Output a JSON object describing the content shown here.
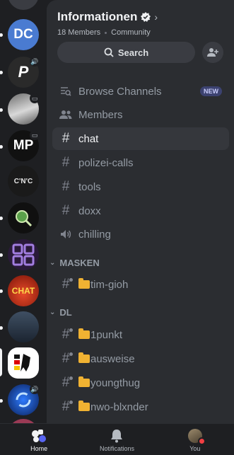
{
  "server": {
    "name": "Informationen",
    "members": "18 Members",
    "type": "Community",
    "search_label": "Search"
  },
  "rail": {
    "items": [
      {
        "label": "DC"
      },
      {
        "label": "P"
      },
      {
        "label": ""
      },
      {
        "label": "MP"
      },
      {
        "label": "C'N'C"
      },
      {
        "label": ""
      },
      {
        "label": ""
      },
      {
        "label": "CHAT"
      },
      {
        "label": ""
      },
      {
        "label": ""
      },
      {
        "label": ""
      }
    ]
  },
  "channels": {
    "browse": {
      "label": "Browse Channels",
      "badge": "NEW"
    },
    "members": {
      "label": "Members"
    },
    "top": [
      {
        "label": "chat",
        "icon": "hash-icon"
      },
      {
        "label": "polizei-calls",
        "icon": "hash-icon"
      },
      {
        "label": "tools",
        "icon": "hash-icon"
      },
      {
        "label": "doxx",
        "icon": "hash-icon"
      },
      {
        "label": "chilling",
        "icon": "speaker-icon"
      }
    ],
    "categories": [
      {
        "name": "MASKEN",
        "items": [
          {
            "label": "tim-gioh"
          }
        ]
      },
      {
        "name": "DL",
        "items": [
          {
            "label": "1punkt"
          },
          {
            "label": "ausweise"
          },
          {
            "label": "youngthug"
          },
          {
            "label": "nwo-blxnder"
          }
        ]
      }
    ]
  },
  "nav": {
    "home": "Home",
    "notifications": "Notifications",
    "you": "You"
  },
  "colors": {
    "panel": "#2b2d31",
    "rail": "#1e1f22",
    "active_row": "#35373c",
    "folder": "#f0b232",
    "new_badge": "#3c4270"
  }
}
